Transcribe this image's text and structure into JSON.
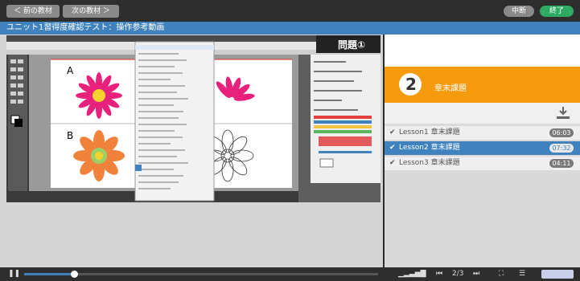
{
  "nav": {
    "prev_label": "＜ 前の教材",
    "next_label": "次の教材 ＞"
  },
  "header": {
    "pause_label": "中断",
    "finish_label": "終了"
  },
  "title": "ユニット1習得度確認テスト：操作参考動画",
  "video": {
    "question_badge": "問題①",
    "label_a": "A",
    "label_b": "B"
  },
  "chapter": {
    "number": "2",
    "title": "章末課題"
  },
  "lessons": [
    {
      "label": "Lesson1 章末課題",
      "duration": "06:03",
      "active": false
    },
    {
      "label": "Lesson2 章末課題",
      "duration": "07:32",
      "active": true
    },
    {
      "label": "Lesson3 章末課題",
      "duration": "04:11",
      "active": false
    }
  ],
  "player": {
    "page": "2/3",
    "progress_fraction": 0.14
  },
  "colors": {
    "accent": "#3f82bd",
    "orange": "#f49a0c",
    "green": "#2eaa63"
  },
  "icons": [
    "pause-icon",
    "volume-icon",
    "first-icon",
    "last-icon",
    "fullscreen-icon",
    "list-icon",
    "brand-logo-icon",
    "download-icon"
  ]
}
